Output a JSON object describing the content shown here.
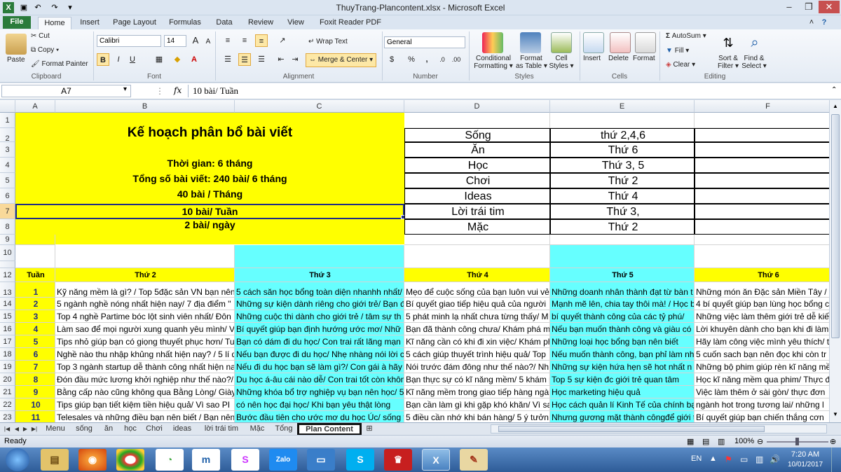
{
  "window": {
    "title": "ThuyTrang-Plancontent.xlsx - Microsoft Excel"
  },
  "tabs": [
    "File",
    "Home",
    "Insert",
    "Page Layout",
    "Formulas",
    "Data",
    "Review",
    "View",
    "Foxit Reader PDF"
  ],
  "ribbon": {
    "clipboard": {
      "paste": "Paste",
      "cut": "Cut",
      "copy": "Copy ▾",
      "format_painter": "Format Painter",
      "label": "Clipboard"
    },
    "font": {
      "name": "Calibri",
      "size": "14",
      "label": "Font"
    },
    "alignment": {
      "wrap": "Wrap Text",
      "merge": "Merge & Center",
      "label": "Alignment"
    },
    "number": {
      "format": "General",
      "label": "Number"
    },
    "styles": {
      "conditional_1": "Conditional",
      "conditional_2": "Formatting ▾",
      "format_table_1": "Format",
      "format_table_2": "as Table ▾",
      "cell_styles_1": "Cell",
      "cell_styles_2": "Styles ▾",
      "label": "Styles"
    },
    "cells": {
      "insert": "Insert",
      "delete": "Delete",
      "format": "Format",
      "label": "Cells"
    },
    "editing": {
      "autosum": "AutoSum ▾",
      "fill": "Fill ▾",
      "clear": "Clear ▾",
      "sort_1": "Sort &",
      "sort_2": "Filter ▾",
      "find_1": "Find &",
      "find_2": "Select ▾",
      "label": "Editing"
    }
  },
  "formula_bar": {
    "name_box": "A7",
    "fx": "fx",
    "content": "10 bài/ Tuần"
  },
  "columns": [
    "A",
    "B",
    "C",
    "D",
    "E",
    "F"
  ],
  "rows": [
    "1",
    "2",
    "3",
    "4",
    "5",
    "6",
    "7",
    "8",
    "9",
    "10",
    "12",
    "13",
    "14",
    "15",
    "16",
    "17",
    "18",
    "19",
    "20",
    "21",
    "22",
    "23"
  ],
  "plan": {
    "title": "Kế hoạch phân bổ bài viết",
    "time": "Thời gian: 6 tháng",
    "total": "Tổng số bài viết: 240 bài/ 6 tháng",
    "per_month": "40 bài / Tháng",
    "per_week": "10 bài/ Tuần",
    "per_day": "2 bài/ ngày"
  },
  "schedule": [
    {
      "topic": "Sống",
      "day": "thứ 2,4,6"
    },
    {
      "topic": "Ăn",
      "day": "Thứ 6"
    },
    {
      "topic": "Học",
      "day": "Thứ 3, 5"
    },
    {
      "topic": "Chơi",
      "day": "Thứ 2"
    },
    {
      "topic": "Ideas",
      "day": "Thứ 4"
    },
    {
      "topic": "Lời trái tim",
      "day": "Thứ 3,"
    },
    {
      "topic": "Mặc",
      "day": "Thứ 2"
    }
  ],
  "table_headers": [
    "Tuần",
    "Thứ 2",
    "Thứ 3",
    "Thứ 4",
    "Thứ 5",
    "Thứ 6"
  ],
  "table_rows": [
    [
      "1",
      "Kỹ năng mềm là gì? / Top 5đặc sản VN bạn nên b",
      "5 cách săn học bổng toàn diện nhanhh nhất/",
      "Mẹo để cuộc sống của bạn luôn vui vẻ,",
      "Những doanh nhân thành đạt từ bàn t",
      "Những món ăn Đặc sản Miền Tây / N"
    ],
    [
      "2",
      "5 ngành nghề nóng nhất hiện nay/ 7 địa điểm \"",
      "Những sự kiện dành riêng cho giới trẻ/ Bạn đ",
      "Bí quyết giao tiếp hiệu quả của người",
      "Mạnh mẽ lên, chia tay thôi mà! / Học b",
      "4 bí quyết giúp bạn lùng học bổng c"
    ],
    [
      "3",
      "Top 4 nghề Partime bóc lột sinh viên nhất/ Đôn",
      "Những cuộc thi dành cho giới trẻ / tâm sự th",
      "5 phát minh lạ nhất chưa từng thấy/ M",
      "bí quyết thành công của các tỷ phú/",
      "Những việc làm thêm giới trẻ dễ kiế"
    ],
    [
      "4",
      "Làm sao để mọi người xung quanh yêu mình/ V",
      "Bí quyết giúp bạn định hướng ước mơ/ Nhữ",
      "Bạn đã thành công chưa/ Khám phá m",
      "Nếu bạn muốn thành công và giàu có",
      "Lời khuyên dành cho bạn khi đi làm"
    ],
    [
      "5",
      "Tips nhỏ giúp bạn có giọng thuyết phục hơn/ Tu",
      "Bạn có dám đi du học/ Con trai rất lãng mạn",
      "Kĩ năng cần có khi đi xin việc/ Khám ph",
      "Những loại học bổng bạn nên biết",
      "Hãy làm công việc mình yêu thích/ t"
    ],
    [
      "6",
      "Nghề nào thu nhập khủng nhất hiện nay? / 5 lí d",
      "Nếu bạn được đi du học/ Nhẹ nhàng nói lời c",
      "5 cách giúp thuyết trình hiệu quả/ Top",
      "Nếu muốn thành công, bạn phỉ làm nh",
      "5 cuốn sach bạn nên đọc khi còn tr"
    ],
    [
      "7",
      "Top 3 ngành startup dễ thành công nhất hiện na",
      "Nếu đi du học bạn sẽ làm gì?/ Con gái à hãy k",
      "Nói trước đám đông như thế nào?/ Nh",
      "Những sự kiện hứa hẹn sẽ hot nhất n",
      "Những bộ phim giúp rèn kĩ năng mề"
    ],
    [
      "8",
      "Đón đầu mức lương khởi nghiệp như thế nào?/",
      "Du học á-âu cái nào dễ/ Con trai tốt còn khôn",
      "Bạn thực sự có kĩ năng mềm/ 5 khám p",
      "Top 5 sự kiện đc giới trẻ quan tâm",
      "Học kĩ năng mềm qua phim/ Thực đ"
    ],
    [
      "9",
      "Bằng cấp nào cũng không qua Bằng Lòng/ Giày b",
      "Những khóa bổ trợ nghiệp vụ bạn nên học/ 5",
      "Kĩ năng mềm trong giao tiếp hàng ngà",
      "Học marketing hiệu quả",
      "Việc làm thêm ở sài gòn/ thực đơn"
    ],
    [
      "10",
      "Tips giúp bạn tiết kiệm tiền hiệu quả/ Vì sao PI",
      "có nên học đại học/ Khi bạn yêu thật lòng",
      "Bạn cần làm gì khi gặp khó khăn/ Vì sa",
      "Học cách quản lí Kinh Tế của chính bạ",
      "ngành hot trong tương lai/ những l"
    ],
    [
      "11",
      "Telesales và những điều bạn nên biết / Bạn nên",
      "Bước đầu tiên cho ước mơ du học Úc/ sống t",
      "5 điều cần nhớ khi bán hàng/ 5 ý tưởn",
      "Nhưng gương mặt thành côngđể giới t",
      "Bí quyết giúp bạn chiến thắng cơn"
    ]
  ],
  "sheets": [
    "Menu",
    "sống",
    "ăn",
    "học",
    "Chơi",
    "ideas",
    "lời trái tim",
    "Mặc",
    "Tổng",
    "Plan Content"
  ],
  "status": {
    "ready": "Ready",
    "zoom": "100%"
  },
  "clock": {
    "time": "7:20 AM",
    "date": "10/01/2017"
  },
  "tray": {
    "lang": "EN"
  },
  "colors": {
    "yellow": "#ffff00",
    "cyan": "#66ffff",
    "selection": "#00008b"
  }
}
